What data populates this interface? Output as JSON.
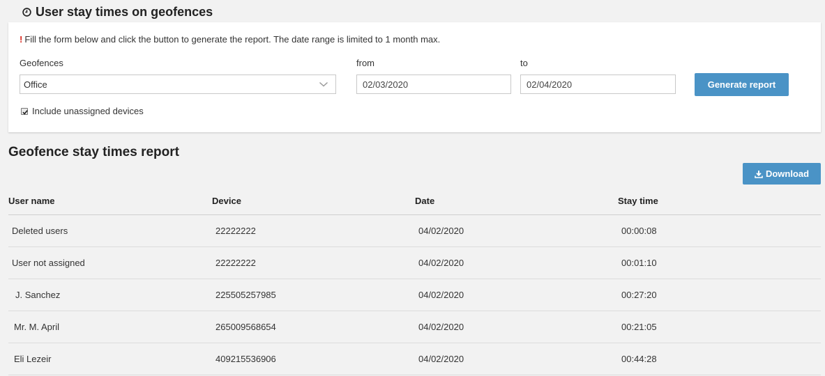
{
  "header": {
    "title": "User stay times on geofences"
  },
  "form": {
    "notice": "Fill the form below and click the button to generate the report. The date range is limited to 1 month max.",
    "geofences_label": "Geofences",
    "geofences_value": "Office",
    "from_label": "from",
    "from_value": "02/03/2020",
    "to_label": "to",
    "to_value": "02/04/2020",
    "generate_label": "Generate report",
    "include_unassigned_label": "Include unassigned devices",
    "include_unassigned_checked": true
  },
  "report": {
    "title": "Geofence stay times report",
    "download_label": "Download",
    "columns": [
      "User name",
      "Device",
      "Date",
      "Stay time"
    ],
    "rows": [
      {
        "user": "Deleted users",
        "device": "22222222",
        "date": "04/02/2020",
        "stay": "00:00:08"
      },
      {
        "user": "User not assigned",
        "device": "22222222",
        "date": "04/02/2020",
        "stay": "00:01:10"
      },
      {
        "user": "J. Sanchez",
        "device": "225505257985",
        "date": "04/02/2020",
        "stay": "00:27:20"
      },
      {
        "user": "Mr. M. April",
        "device": "265009568654",
        "date": "04/02/2020",
        "stay": "00:21:05"
      },
      {
        "user": "Eli Lezeir",
        "device": "409215536906",
        "date": "04/02/2020",
        "stay": "00:44:28"
      }
    ]
  },
  "colors": {
    "accent": "#4a93c6",
    "alert": "#d9261c",
    "background": "#f2f2f2"
  },
  "icons": {
    "header": "clock-icon",
    "dropdown": "chevron-down-icon",
    "download": "download-icon",
    "notice": "exclamation-icon"
  }
}
